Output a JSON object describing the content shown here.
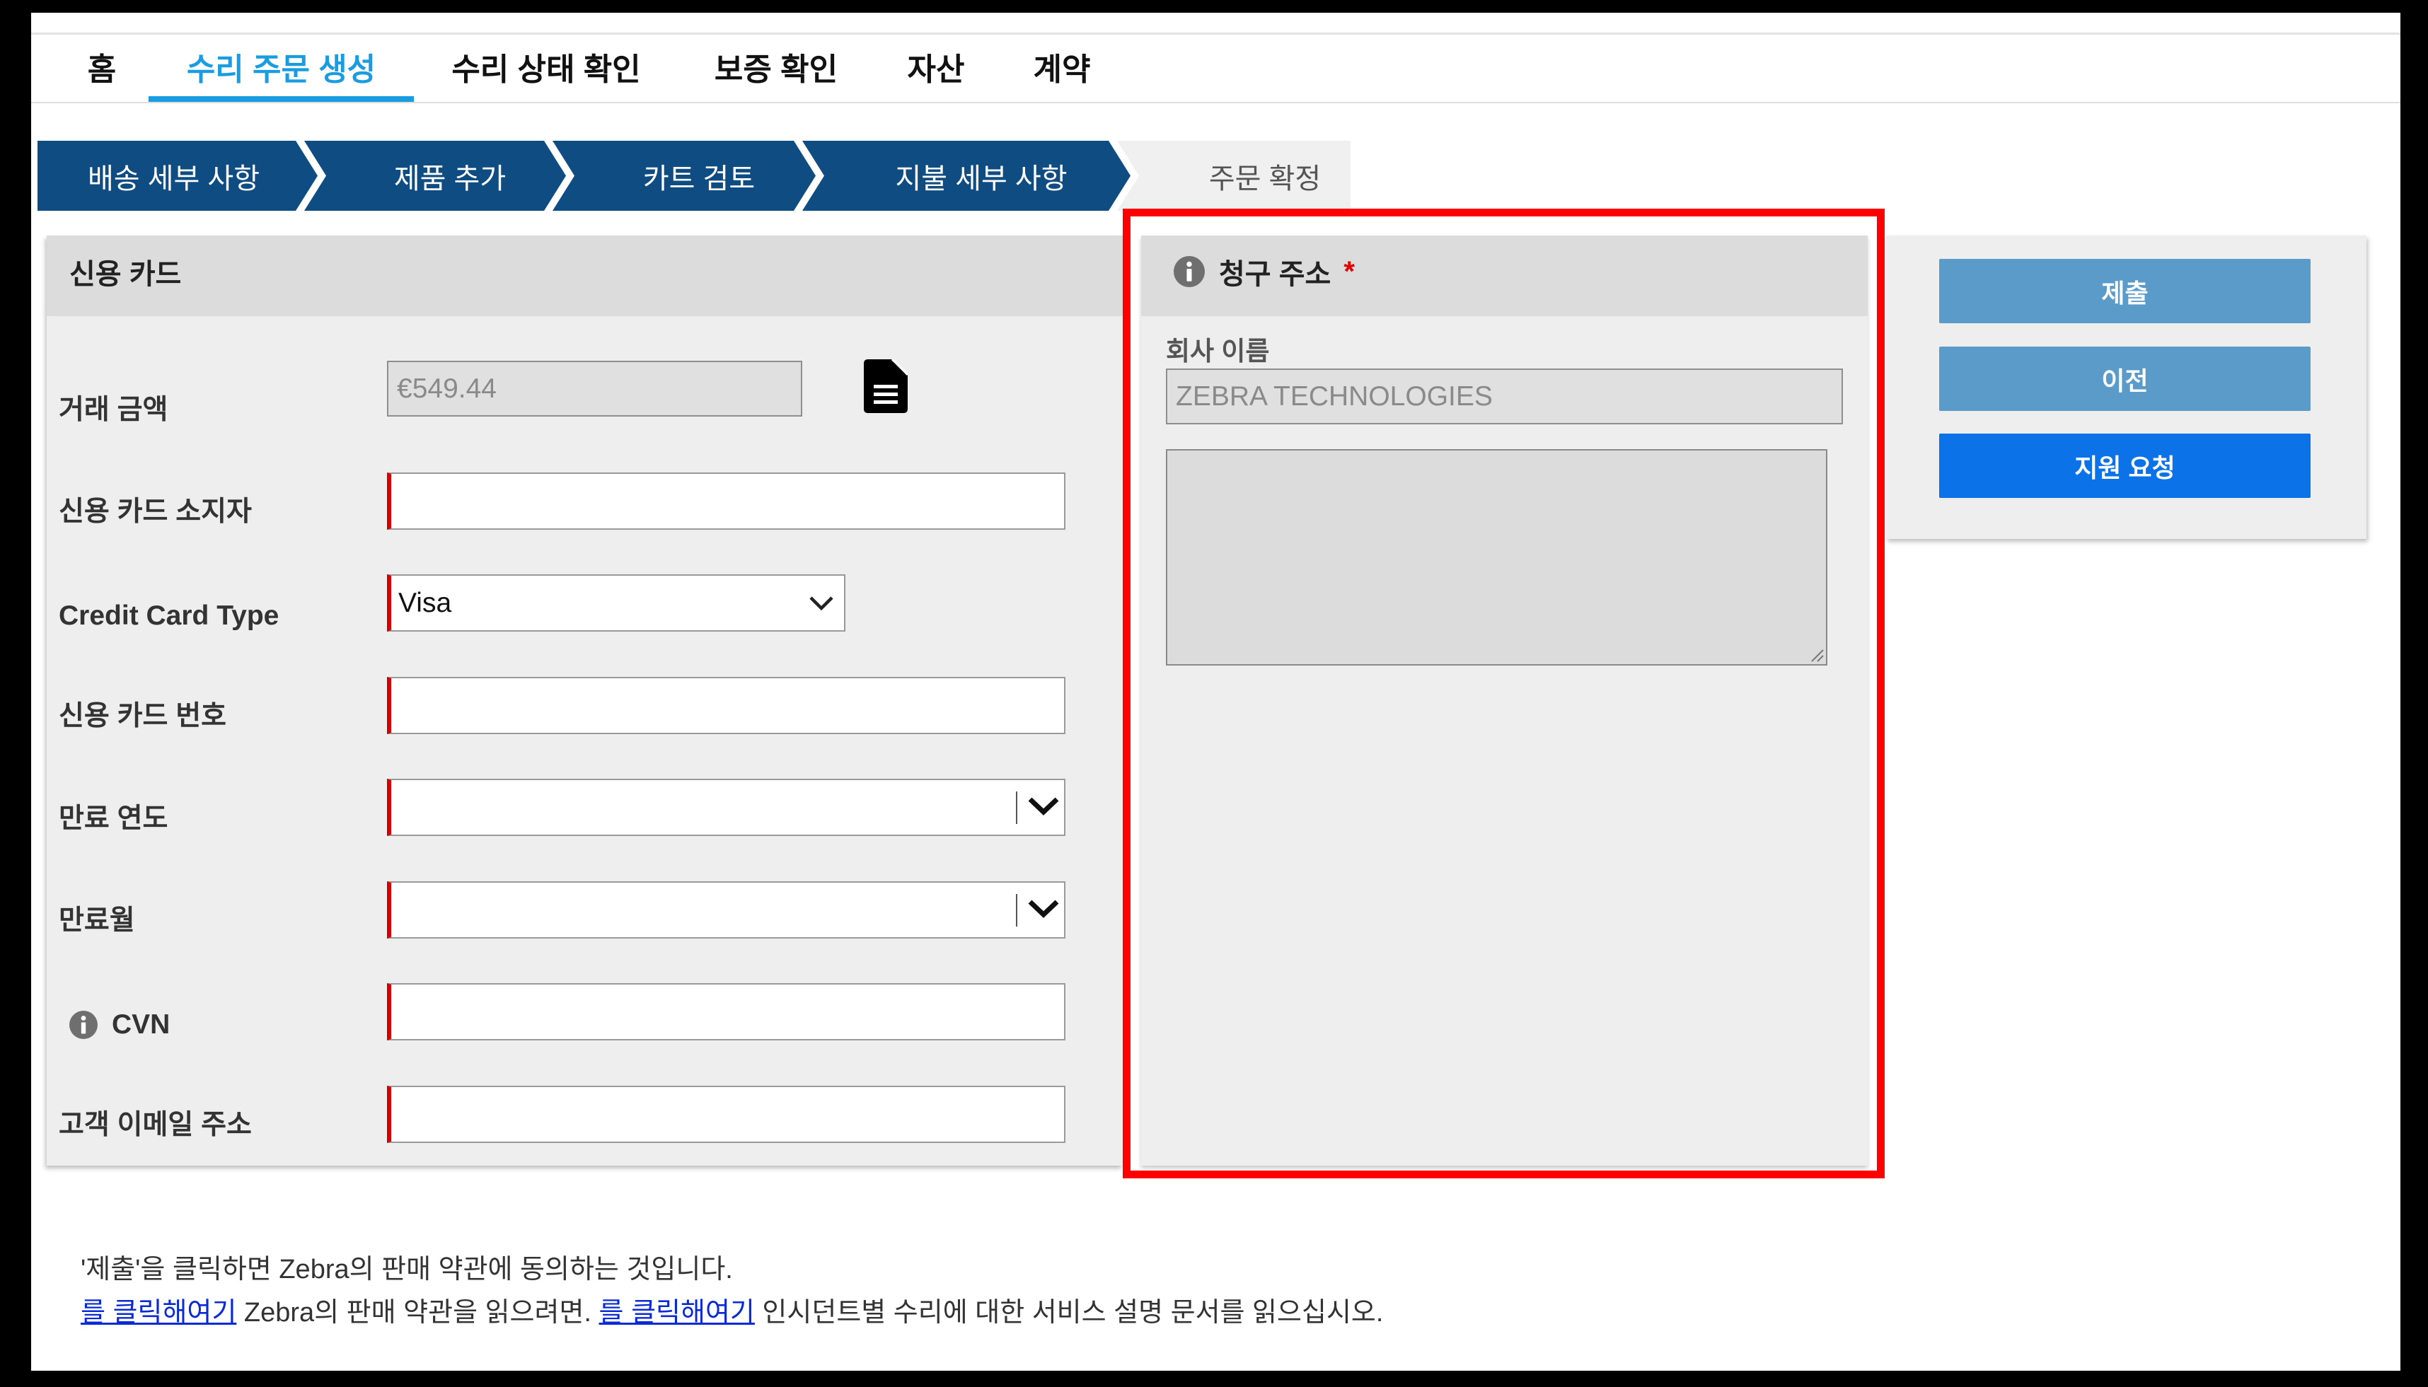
{
  "nav": {
    "tabs": [
      {
        "label": "홈",
        "active": false
      },
      {
        "label": "수리 주문 생성",
        "active": true
      },
      {
        "label": "수리 상태 확인",
        "active": false
      },
      {
        "label": "보증 확인",
        "active": false
      },
      {
        "label": "자산",
        "active": false
      },
      {
        "label": "계약",
        "active": false
      }
    ]
  },
  "steps": [
    {
      "label": "배송 세부 사항",
      "done": true
    },
    {
      "label": "제품 추가",
      "done": true
    },
    {
      "label": "카트 검토",
      "done": true
    },
    {
      "label": "지불 세부 사항",
      "done": true
    },
    {
      "label": "주문 확정",
      "done": false
    }
  ],
  "credit_card": {
    "title": "신용 카드",
    "amount": {
      "label": "거래 금액",
      "value": "€549.44"
    },
    "holder": {
      "label": "신용 카드 소지자",
      "value": ""
    },
    "type": {
      "label": "Credit Card Type",
      "value": "Visa"
    },
    "number": {
      "label": "신용 카드 번호",
      "value": ""
    },
    "exp_year": {
      "label": "만료 연도",
      "value": ""
    },
    "exp_month": {
      "label": "만료월",
      "value": ""
    },
    "cvn": {
      "label": "CVN",
      "value": ""
    },
    "email": {
      "label": "고객 이메일 주소",
      "value": ""
    }
  },
  "billing_address": {
    "title": "청구 주소",
    "required_mark": "*",
    "company_label": "회사 이름",
    "company_value": "ZEBRA TECHNOLOGIES",
    "address_value": ""
  },
  "actions": {
    "submit": "제출",
    "previous": "이전",
    "support": "지원 요청"
  },
  "footer": {
    "agreement": "'제출'을 클릭하면 Zebra의 판매 약관에 동의하는 것입니다.",
    "terms_link": "를 클릭해여기",
    "terms_text": " Zebra의 판매 약관을 읽으려면. ",
    "service_link": "를 클릭해여기",
    "service_text": " 인시던트별 수리에 대한 서비스 설명 문서를 읽으십시오."
  },
  "icons": {
    "invoice": "document-icon",
    "info": "info-icon",
    "dropdown": "chevron-down-icon",
    "resize": "resize-handle-icon"
  },
  "colors": {
    "brand_navy": "#0f4c81",
    "active_tab": "#1a9de0",
    "required": "#e00000",
    "button_secondary": "#5b9bc9",
    "button_support": "#0b72e7",
    "highlight": "#ff0000",
    "link": "#0a2ad6",
    "invalid_field_marker": "#d40000"
  }
}
